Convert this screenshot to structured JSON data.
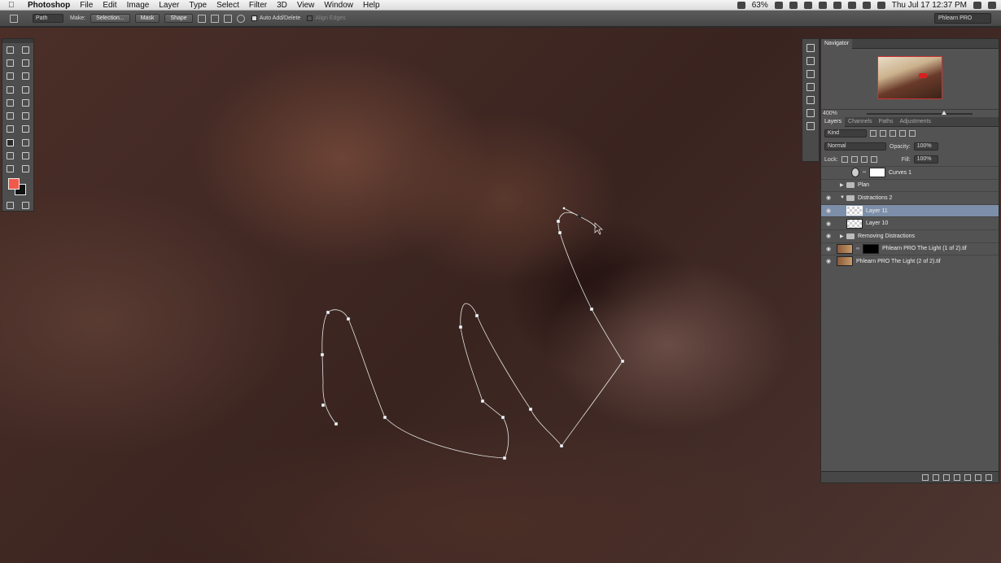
{
  "menubar": {
    "app": "Photoshop",
    "items": [
      "File",
      "Edit",
      "Image",
      "Layer",
      "Type",
      "Select",
      "Filter",
      "3D",
      "View",
      "Window",
      "Help"
    ],
    "battery": "63%",
    "clock": "Thu Jul 17  12:37 PM"
  },
  "options": {
    "mode": "Path",
    "make_label": "Make:",
    "selection_btn": "Selection...",
    "mask_btn": "Mask",
    "shape_btn": "Shape",
    "auto_add_delete": "Auto Add/Delete",
    "align_edges": "Align Edges",
    "workspace": "Phlearn PRO"
  },
  "navigator": {
    "tab": "Navigator",
    "zoom": "400%"
  },
  "layers_panel": {
    "tabs": [
      "Layers",
      "Channels",
      "Paths",
      "Adjustments"
    ],
    "filter": "Kind",
    "blend_mode": "Normal",
    "opacity_label": "Opacity:",
    "opacity": "100%",
    "lock_label": "Lock:",
    "fill_label": "Fill:",
    "fill": "100%",
    "layers": [
      {
        "name": "Curves 1"
      },
      {
        "name": "Plan"
      },
      {
        "name": "Distractions 2"
      },
      {
        "name": "Layer 11"
      },
      {
        "name": "Layer 10"
      },
      {
        "name": "Removing Distractions"
      },
      {
        "name": "Phlearn PRO The Light (1 of 2).tif"
      },
      {
        "name": "Phlearn PRO The Light (2 of 2).tif"
      }
    ]
  },
  "colors": {
    "foreground": "#f15a4b",
    "background": "#111111",
    "selected_layer": "#7d8fa8"
  }
}
